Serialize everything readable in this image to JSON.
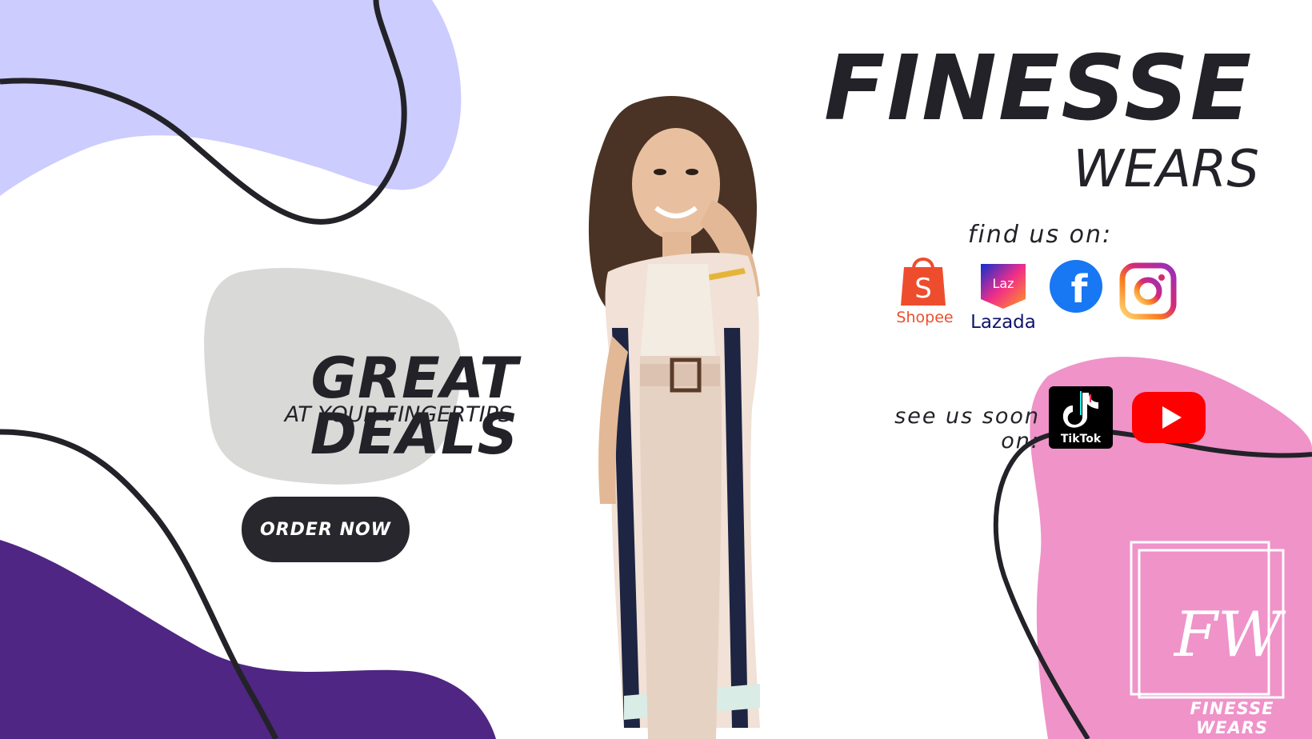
{
  "brand": {
    "title": "FINESSE",
    "subtitle": "WEARS"
  },
  "find_us": {
    "label": "find us on:",
    "platforms": [
      {
        "name": "Shopee",
        "icon": "shopee-icon",
        "color": "#ee4d2d"
      },
      {
        "name": "Lazada",
        "icon": "lazada-icon",
        "color": "#0f146d"
      },
      {
        "name": "Facebook",
        "icon": "facebook-icon",
        "color": "#1877f2"
      },
      {
        "name": "Instagram",
        "icon": "instagram-icon",
        "color": "#d62976"
      }
    ]
  },
  "see_us": {
    "label": "see us soon on:",
    "platforms": [
      {
        "name": "TikTok",
        "icon": "tiktok-icon",
        "color": "#000000"
      },
      {
        "name": "YouTube",
        "icon": "youtube-icon",
        "color": "#ff0000"
      }
    ]
  },
  "promo": {
    "title": "GREAT DEALS",
    "subtitle": "AT YOUR FINGERTIPS",
    "button_label": "ORDER NOW"
  },
  "logo": {
    "monogram": "FW",
    "caption": "FINESSE WEARS"
  },
  "colors": {
    "lavender": "#ccccff",
    "purple": "#4f2683",
    "pink": "#ef93c9",
    "grey_blob": "#d9d9d7",
    "dark": "#232228"
  }
}
